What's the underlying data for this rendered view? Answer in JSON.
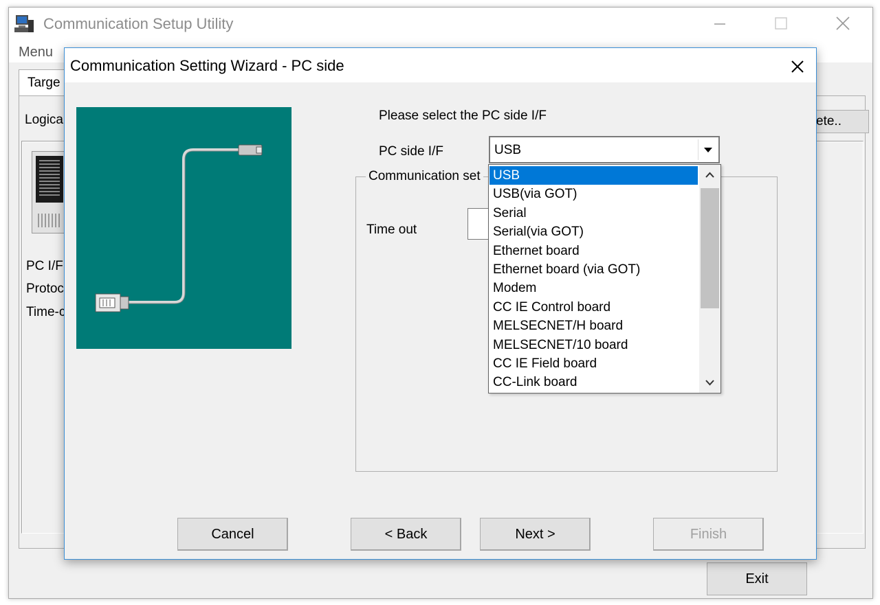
{
  "main_window": {
    "title": "Communication Setup Utility",
    "menu": "Menu",
    "tab": "Targe",
    "logical_label": "Logica",
    "pc_if_label": "PC I/F",
    "protocol_label": "Protoc",
    "timeout_label": "Time-c",
    "delete_button": "ete..",
    "exit_button": "Exit"
  },
  "wizard": {
    "title": "Communication Setting Wizard - PC side",
    "prompt": "Please select the PC side I/F",
    "pc_side_if_label": "PC side I/F",
    "pc_side_if_value": "USB",
    "comm_group_label": "Communication set",
    "timeout_label": "Time out",
    "buttons": {
      "cancel": "Cancel",
      "back": "< Back",
      "next": "Next >",
      "finish": "Finish"
    },
    "illustration_color": "#007b77"
  },
  "dropdown": {
    "selected_index": 0,
    "items": [
      "USB",
      "USB(via GOT)",
      "Serial",
      "Serial(via GOT)",
      "Ethernet board",
      "Ethernet board (via GOT)",
      "Modem",
      "CC IE Control board",
      "MELSECNET/H board",
      "MELSECNET/10 board",
      "CC IE Field board",
      "CC-Link board"
    ]
  },
  "colors": {
    "selection": "#0078d7",
    "dialog_border": "#3c8fd6"
  }
}
